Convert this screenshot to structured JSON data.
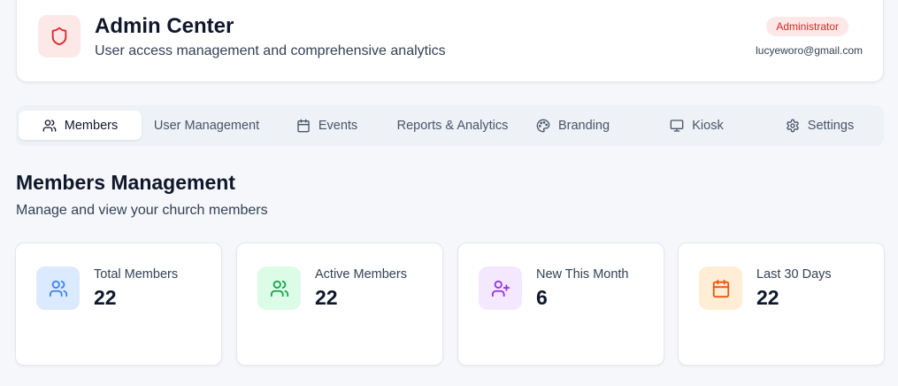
{
  "header": {
    "title": "Admin Center",
    "subtitle": "User access management and comprehensive analytics",
    "role_badge": "Administrator",
    "user_email": "lucyeworo@gmail.com",
    "icon": "shield-icon"
  },
  "tabs": [
    {
      "label": "Members",
      "icon": "users-icon",
      "active": true
    },
    {
      "label": "User Management",
      "icon": "",
      "active": false
    },
    {
      "label": "Events",
      "icon": "calendar-icon",
      "active": false
    },
    {
      "label": "Reports & Analytics",
      "icon": "",
      "active": false
    },
    {
      "label": "Branding",
      "icon": "palette-icon",
      "active": false
    },
    {
      "label": "Kiosk",
      "icon": "monitor-icon",
      "active": false
    },
    {
      "label": "Settings",
      "icon": "gear-icon",
      "active": false
    }
  ],
  "section": {
    "title": "Members Management",
    "subtitle": "Manage and view your church members"
  },
  "stats": [
    {
      "label": "Total Members",
      "value": "22",
      "icon": "users-icon",
      "color": "#3b82f6",
      "bg": "#dbeafe"
    },
    {
      "label": "Active Members",
      "value": "22",
      "icon": "users-icon",
      "color": "#16a34a",
      "bg": "#dcfce7"
    },
    {
      "label": "New This Month",
      "value": "6",
      "icon": "user-plus-icon",
      "color": "#9333ea",
      "bg": "#f3e8ff"
    },
    {
      "label": "Last 30 Days",
      "value": "22",
      "icon": "calendar-icon",
      "color": "#ea580c",
      "bg": "#ffedd5"
    }
  ],
  "colors": {
    "accent_red": "#dc2626",
    "badge_bg": "#fde8e8"
  }
}
